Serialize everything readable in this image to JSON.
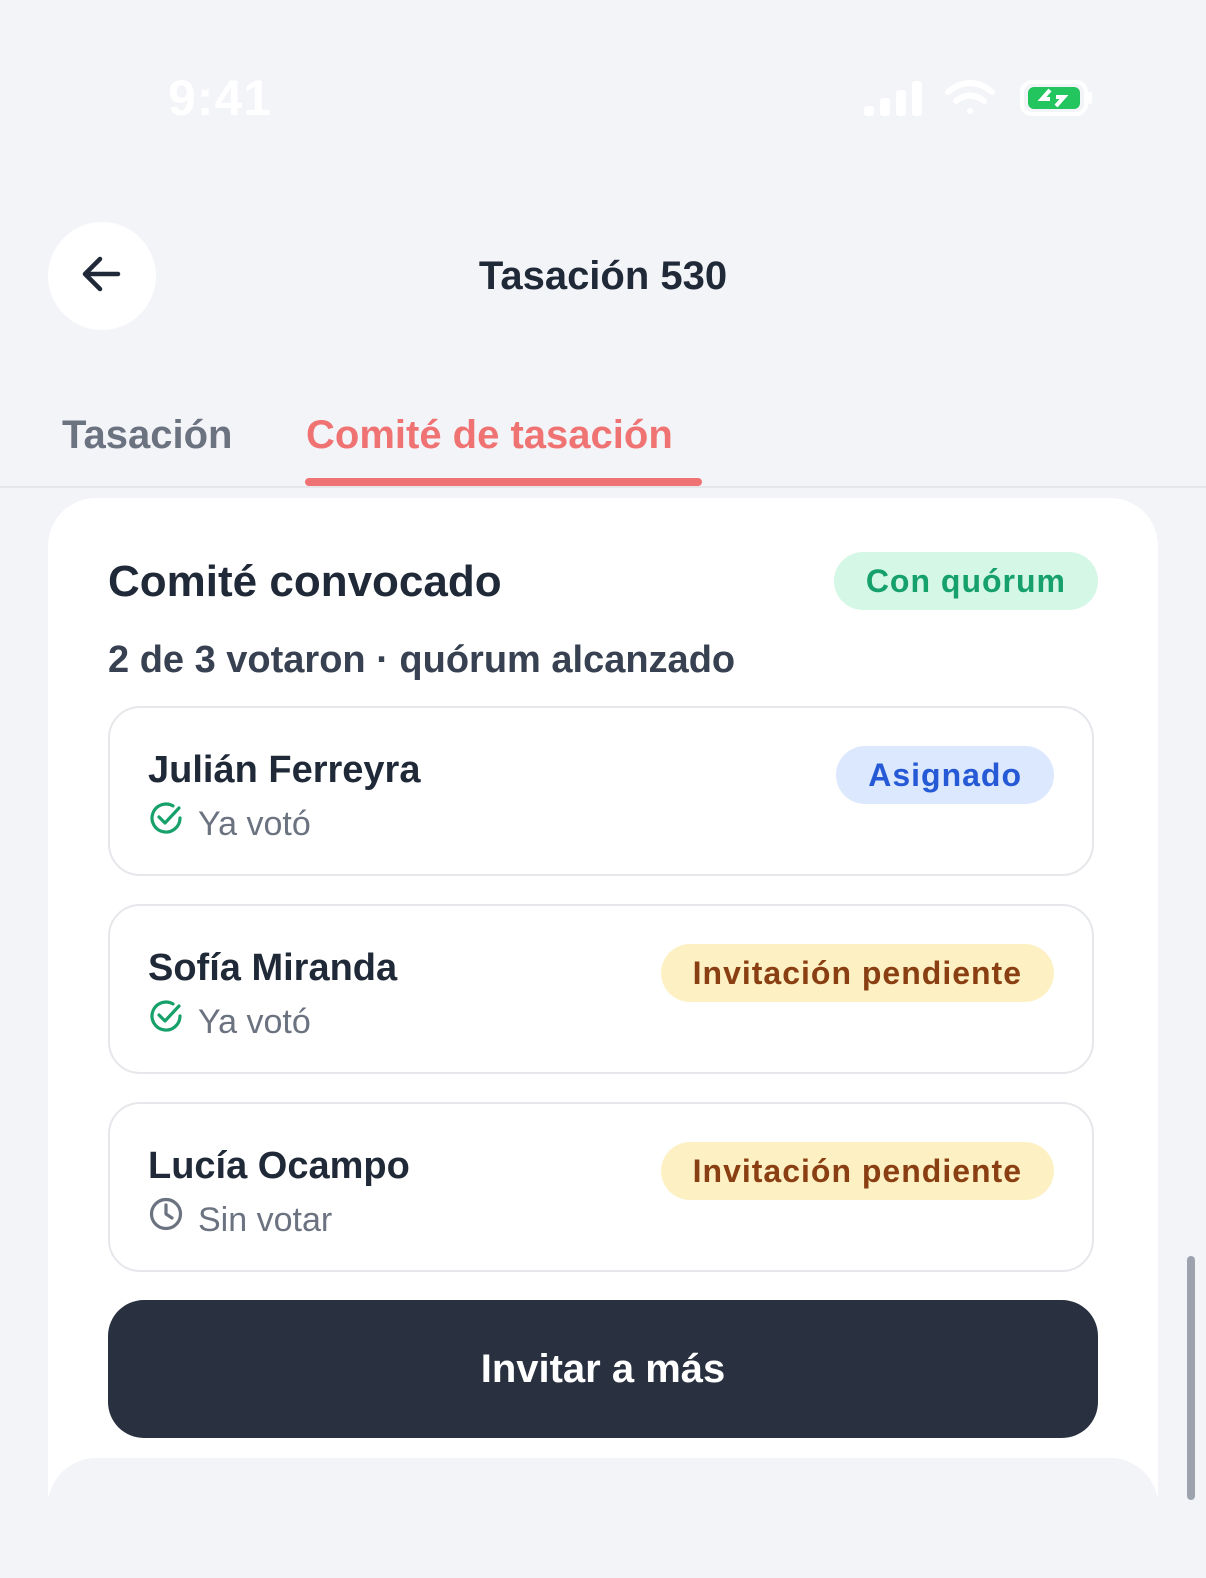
{
  "status_bar": {
    "time": "9:41"
  },
  "header": {
    "title": "Tasación 530"
  },
  "tabs": [
    {
      "label": "Tasación"
    },
    {
      "label": "Comité de tasación",
      "active": true
    }
  ],
  "committee": {
    "title": "Comité convocado",
    "quorum_badge": "Con quórum",
    "subtitle": "2 de 3 votaron · quórum alcanzado",
    "members": [
      {
        "name": "Julián Ferreyra",
        "vote_status": "Ya votó",
        "vote_icon": "check-circle-icon",
        "badge": "Asignado",
        "badge_color": "#2559d6"
      },
      {
        "name": "Sofía Miranda",
        "vote_status": "Ya votó",
        "vote_icon": "check-circle-icon",
        "badge": "Invitación pendiente",
        "badge_color": "#8a3f12"
      },
      {
        "name": "Lucía Ocampo",
        "vote_status": "Sin votar",
        "vote_icon": "clock-icon",
        "badge": "Invitación pendiente",
        "badge_color": "#8a3f12"
      }
    ],
    "invite_button": "Invitar a más"
  },
  "colors": {
    "accent": "#f07373",
    "success": "#16a06a",
    "primary_button": "#293040"
  }
}
